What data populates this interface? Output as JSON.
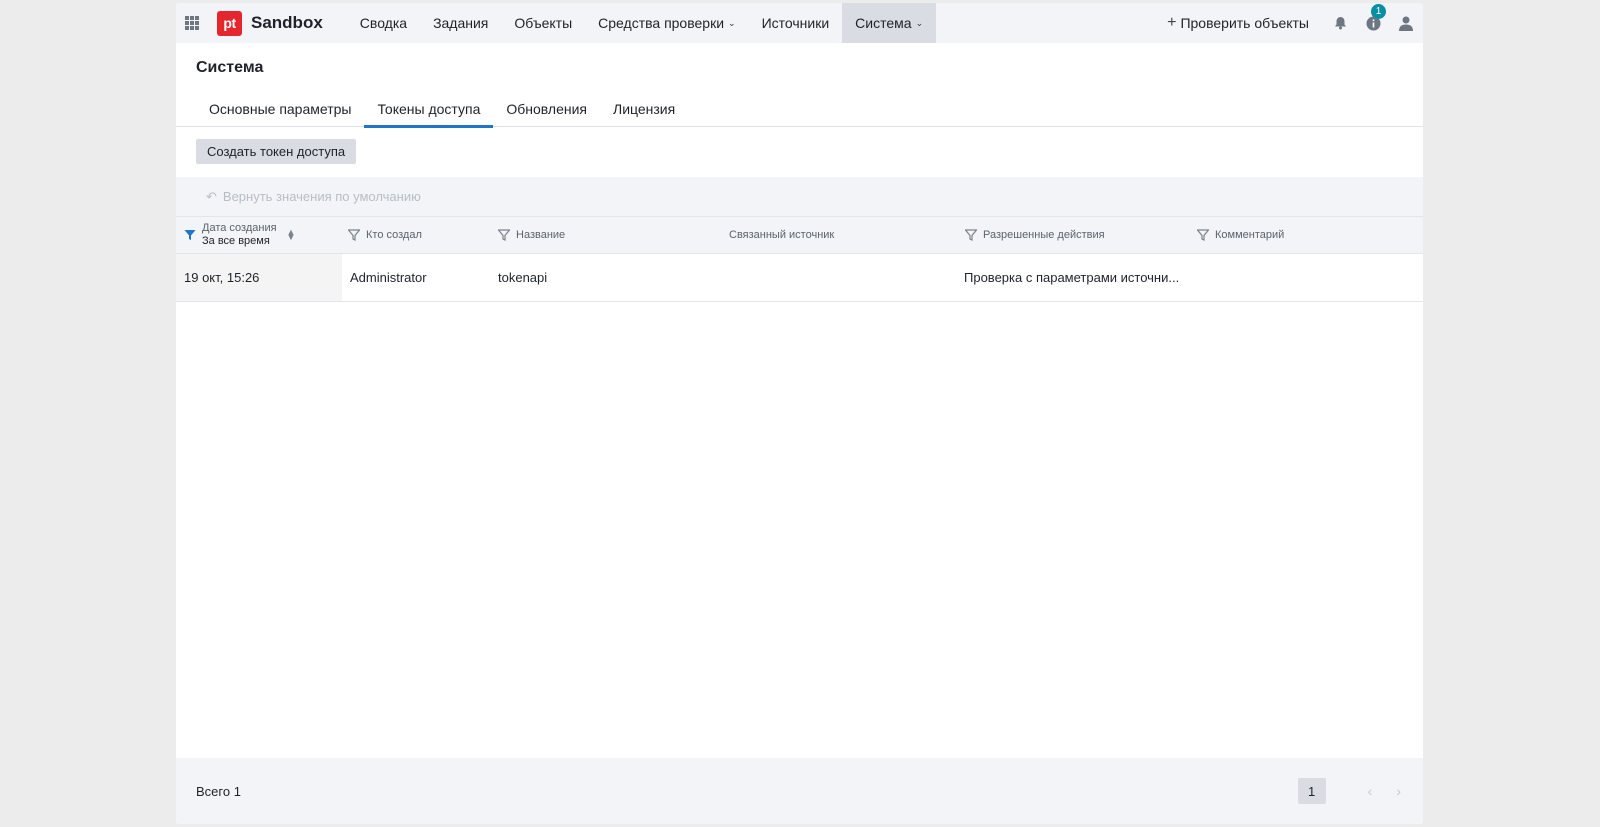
{
  "app": {
    "logo_text": "pt",
    "brand": "Sandbox"
  },
  "nav": {
    "items": [
      {
        "label": "Сводка"
      },
      {
        "label": "Задания"
      },
      {
        "label": "Объекты"
      },
      {
        "label": "Средства проверки"
      },
      {
        "label": "Источники"
      },
      {
        "label": "Система"
      }
    ],
    "check_objects": "Проверить объекты",
    "notification_badge": "1"
  },
  "page": {
    "title": "Система",
    "tabs": [
      {
        "label": "Основные параметры"
      },
      {
        "label": "Токены доступа"
      },
      {
        "label": "Обновления"
      },
      {
        "label": "Лицензия"
      }
    ],
    "create_button": "Создать токен доступа",
    "reset_defaults": "Вернуть значения по умолчанию"
  },
  "table": {
    "columns": [
      {
        "label": "Дата создания",
        "sublabel": "За все время"
      },
      {
        "label": "Кто создал"
      },
      {
        "label": "Название"
      },
      {
        "label": "Связанный источник"
      },
      {
        "label": "Разрешенные действия"
      },
      {
        "label": "Комментарий"
      }
    ],
    "rows": [
      {
        "date": "19 окт, 15:26",
        "author": "Administrator",
        "name": "tokenapi",
        "source": "",
        "actions": "Проверка с параметрами источни...",
        "comment": ""
      }
    ]
  },
  "footer": {
    "total": "Всего 1",
    "current_page": "1"
  },
  "colors": {
    "accent": "#1f75cb",
    "brand": "#e5262c",
    "badge": "#0a8ea3"
  }
}
